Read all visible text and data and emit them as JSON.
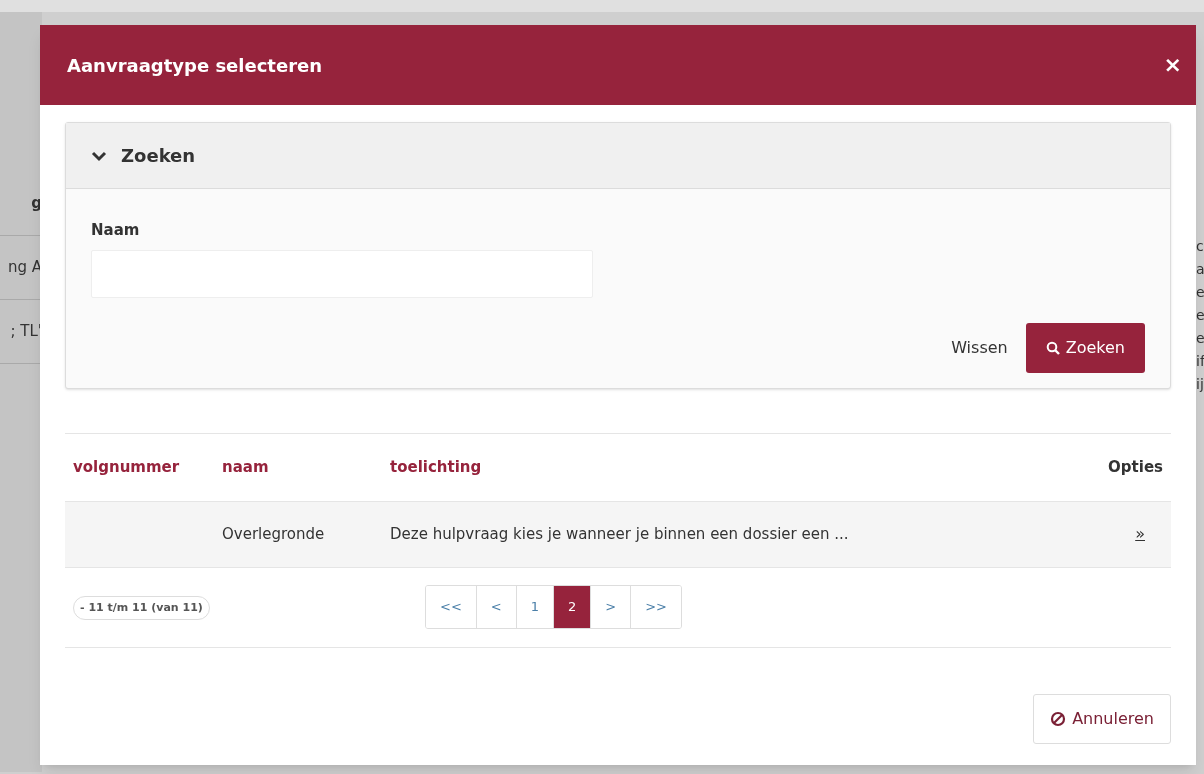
{
  "background": {
    "left_items": [
      "g",
      "ng A",
      "; TL'"
    ],
    "right_lines": [
      "c",
      "a",
      "e",
      "e",
      "e",
      "if",
      "ij"
    ]
  },
  "dialog": {
    "title": "Aanvraagtype selecteren",
    "close": "×"
  },
  "search": {
    "title": "Zoeken",
    "expanded": true,
    "field": {
      "label": "Naam"
    },
    "clear": "Wissen",
    "submit": "Zoeken"
  },
  "table": {
    "columns": [
      "volgnummer",
      "naam",
      "toelichting",
      "Opties"
    ],
    "rows": [
      {
        "cells": [
          "",
          "Overlegronde",
          "Deze hulpvraag kies je wanneer je binnen een dossier een ..."
        ],
        "action": "»"
      }
    ]
  },
  "range": "- 11 t/m 11 (van 11)",
  "pagination": [
    {
      "label": "<<",
      "selected": false
    },
    {
      "label": "<",
      "selected": false
    },
    {
      "label": "1",
      "selected": false
    },
    {
      "label": "2",
      "selected": true
    },
    {
      "label": ">",
      "selected": false
    },
    {
      "label": ">>",
      "selected": false
    }
  ],
  "cancel": "Annuleren"
}
